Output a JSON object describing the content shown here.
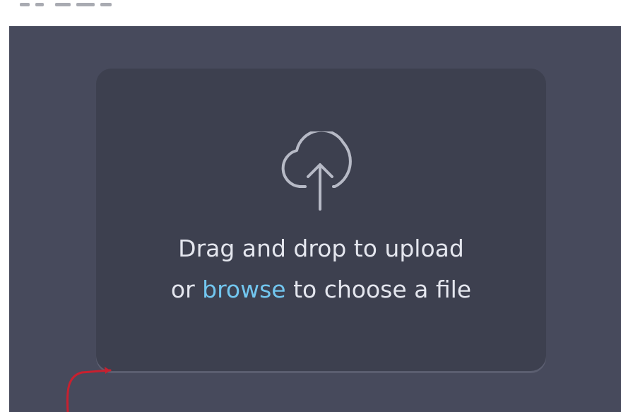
{
  "upload": {
    "line1": "Drag and drop to upload",
    "line2_prefix": "or ",
    "browse_label": "browse",
    "line2_suffix": " to choose a file"
  },
  "icons": {
    "upload": "cloud-upload-icon"
  },
  "colors": {
    "panel_background": "#474a5c",
    "dropzone_background": "#3d404f",
    "text": "#e4e6ee",
    "link": "#72c6ef",
    "icon_stroke": "#b7bac6",
    "annotation": "#c8202f"
  }
}
